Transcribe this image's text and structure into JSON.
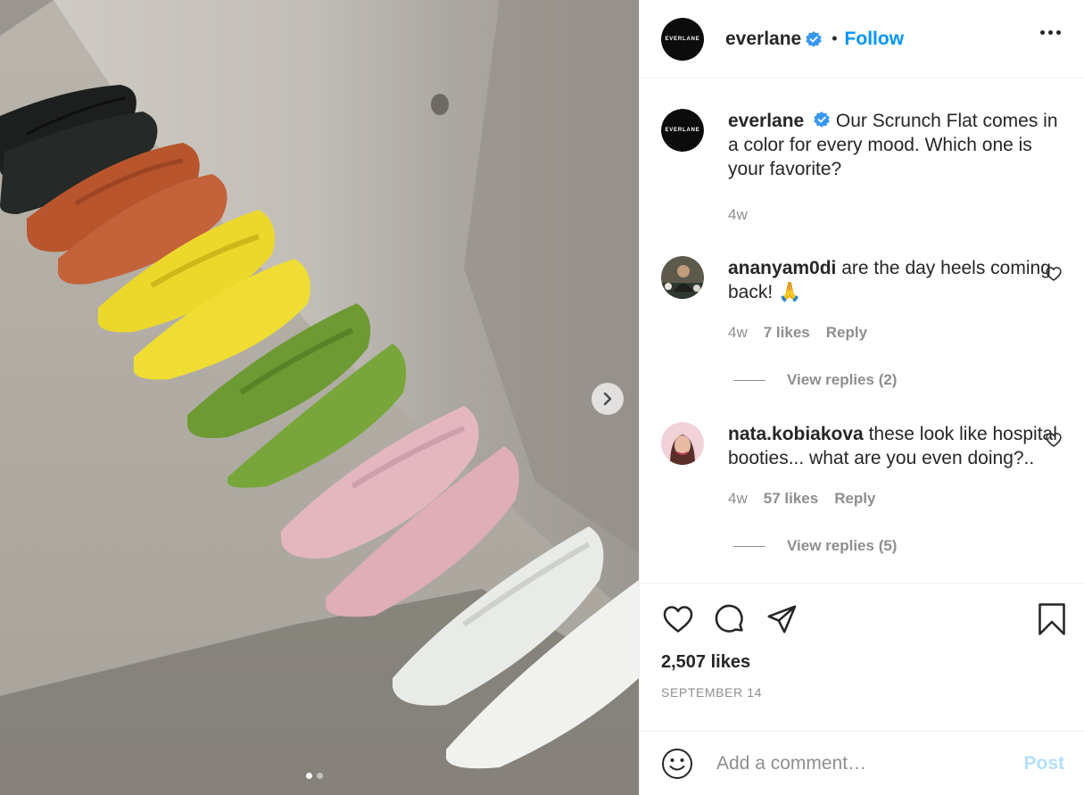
{
  "post": {
    "brand_avatar_text": "EVERLANE",
    "username": "everlane",
    "follow_label": "Follow",
    "separator": "•",
    "caption": {
      "username": "everlane",
      "text": "Our Scrunch Flat comes in a color for every mood. Which one is your favorite?",
      "time": "4w"
    },
    "carousel": {
      "active_slide": 1,
      "slide_count": 2
    },
    "likes_text": "2,507 likes",
    "date": "SEPTEMBER 14"
  },
  "comments": [
    {
      "username": "ananyam0di",
      "text": "are the day heels coming back!",
      "emoji": "🙏",
      "time": "4w",
      "likes": "7 likes",
      "reply": "Reply",
      "view_replies": "View replies (2)"
    },
    {
      "username": "nata.kobiakova",
      "text": "these look like hospital booties... what are you even doing?..",
      "time": "4w",
      "likes": "57 likes",
      "reply": "Reply",
      "view_replies": "View replies (5)"
    }
  ],
  "add_comment": {
    "placeholder": "Add a comment…",
    "post_label": "Post"
  },
  "icons": {
    "verified": "verified-badge-icon",
    "more": "more-options-icon",
    "like": "heart-icon",
    "comment": "comment-bubble-icon",
    "share": "paper-plane-icon",
    "save": "bookmark-icon",
    "emoji": "smiley-icon",
    "next": "chevron-right-icon"
  },
  "colors": {
    "accent": "#0095f6",
    "post_disabled": "#b2dffc",
    "muted": "#8e8e8e",
    "text": "#262626",
    "shoes": [
      "#1c1f1e",
      "#b8552d",
      "#ecd82a",
      "#6d9a33",
      "#e4b7c0",
      "#e9ebe8"
    ]
  }
}
